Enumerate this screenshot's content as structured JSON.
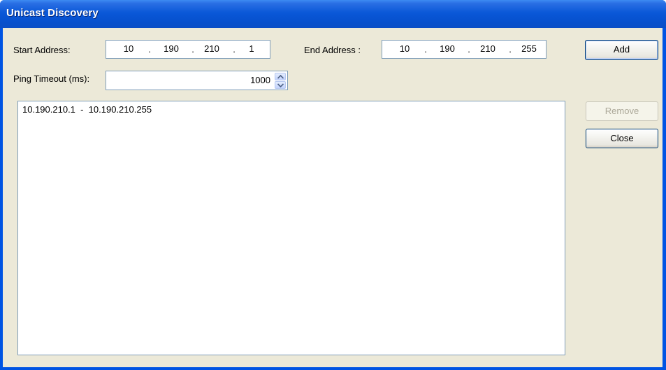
{
  "window": {
    "title": "Unicast Discovery"
  },
  "form": {
    "start_label": "Start Address:",
    "start_address": [
      "10",
      "190",
      "210",
      "1"
    ],
    "end_label": "End Address :",
    "end_address": [
      "10",
      "190",
      "210",
      "255"
    ],
    "ip_separator": ".",
    "ping_label": "Ping Timeout (ms):",
    "ping_value": "1000"
  },
  "list": {
    "items": [
      "10.190.210.1  -  10.190.210.255"
    ]
  },
  "buttons": {
    "add": "Add",
    "remove": "Remove",
    "close": "Close"
  },
  "icons": {
    "spinner_up": "chevron-up-icon",
    "spinner_down": "chevron-down-icon"
  }
}
